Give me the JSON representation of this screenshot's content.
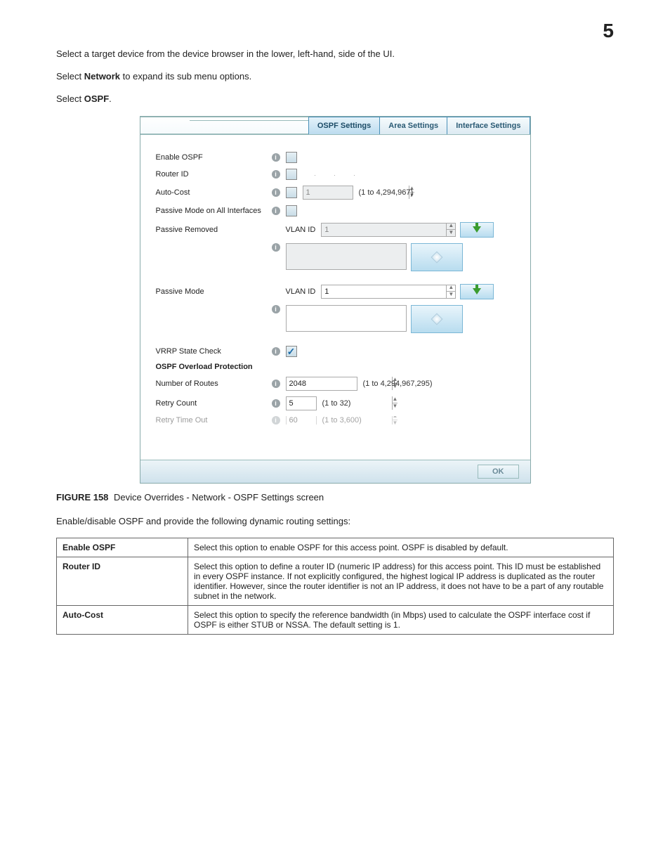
{
  "page_number": "5",
  "intro": {
    "p1_a": "Select a target device from the device browser in the lower, left-hand, side of the UI.",
    "p2_a": "Select ",
    "p2_b": "Network",
    "p2_c": " to expand its sub menu options.",
    "p3_a": "Select ",
    "p3_b": "OSPF",
    "p3_c": "."
  },
  "tabs": {
    "t1": "OSPF Settings",
    "t2": "Area Settings",
    "t3": "Interface Settings"
  },
  "form": {
    "enable_ospf": "Enable OSPF",
    "router_id": "Router ID",
    "auto_cost": "Auto-Cost",
    "auto_cost_val": "1",
    "auto_cost_hint": "(1 to 4,294,967)",
    "passive_all": "Passive Mode on All Interfaces",
    "passive_removed": "Passive Removed",
    "vlan_id": "VLAN ID",
    "vlan_val_disabled": "1",
    "passive_mode": "Passive Mode",
    "vlan_val_active": "1",
    "vrrp": "VRRP State Check",
    "overload_hdr": "OSPF Overload Protection",
    "num_routes": "Number of Routes",
    "num_routes_val": "2048",
    "num_routes_hint": "(1 to 4,294,967,295)",
    "retry_count": "Retry Count",
    "retry_count_val": "5",
    "retry_count_hint": "(1 to 32)",
    "retry_timeout": "Retry Time Out",
    "retry_timeout_val": "60",
    "retry_timeout_hint": "(1 to 3,600)",
    "ok": "OK"
  },
  "caption": {
    "fig": "FIGURE 158",
    "text": "Device Overrides - Network - OSPF Settings screen"
  },
  "post_para": "Enable/disable OSPF and provide the following dynamic routing settings:",
  "table": [
    {
      "k": "Enable OSPF",
      "v": "Select this option to enable OSPF for this access point. OSPF is disabled by default."
    },
    {
      "k": "Router ID",
      "v": "Select this option to define a router ID (numeric IP address) for this access point. This ID must be established in every OSPF instance. If not explicitly configured, the highest logical IP address is duplicated as the router identifier. However, since the router identifier is not an IP address, it does not have to be a part of any routable subnet in the network."
    },
    {
      "k": "Auto-Cost",
      "v": "Select this option to specify the reference bandwidth (in Mbps) used to calculate the OSPF interface cost if OSPF is either STUB or NSSA. The default setting is 1."
    }
  ]
}
